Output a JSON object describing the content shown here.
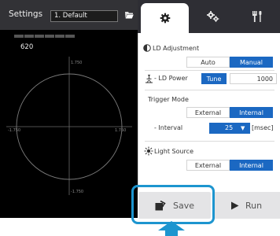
{
  "header": {
    "settings_label": "Settings",
    "profile_value": "1. Default"
  },
  "preview": {
    "value": "620",
    "level_bars": 6,
    "ticks": {
      "top": "1.750",
      "left": "-1.750",
      "right": "1.750",
      "bottom": "-1.750"
    }
  },
  "tabs": [
    {
      "name": "settings",
      "icon": "gear-icon",
      "active": true
    },
    {
      "name": "adjustment",
      "icon": "gears-icon",
      "active": false
    },
    {
      "name": "tools",
      "icon": "tools-icon",
      "active": false
    }
  ],
  "panel": {
    "ld_adjustment": {
      "title": "LD Adjustment",
      "options": [
        "Auto",
        "Manual"
      ],
      "selected": "Manual"
    },
    "ld_power": {
      "label": "- LD Power",
      "tune_label": "Tune",
      "value": "1000"
    },
    "trigger_mode": {
      "title": "Trigger Mode",
      "options": [
        "External",
        "Internal"
      ],
      "selected": "Internal",
      "interval_label": "- Interval",
      "interval_value": "25",
      "interval_unit": "[msec]"
    },
    "light_source": {
      "title": "Light Source",
      "options": [
        "External",
        "Internal"
      ],
      "selected": "Internal"
    }
  },
  "actions": {
    "save_label": "Save",
    "run_label": "Run"
  },
  "colors": {
    "accent": "#1b68c2",
    "highlight": "#1d95cf",
    "dark_bg": "#000000",
    "tab_bar": "#2e2e34"
  }
}
